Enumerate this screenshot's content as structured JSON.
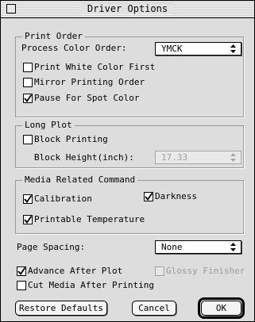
{
  "window": {
    "title": "Driver Options"
  },
  "print_order": {
    "group_title": "Print Order",
    "process_color_label": "Process Color Order:",
    "process_color_value": "YMCK",
    "print_white_first": {
      "label": "Print White Color First",
      "checked": false
    },
    "mirror_printing_order": {
      "label": "Mirror Printing Order",
      "checked": false
    },
    "pause_for_spot_color": {
      "label": "Pause For Spot Color",
      "checked": true
    }
  },
  "long_plot": {
    "group_title": "Long Plot",
    "block_printing": {
      "label": "Block Printing",
      "checked": false
    },
    "block_height_label": "Block Height(inch):",
    "block_height_value": "17.33"
  },
  "media_related": {
    "group_title": "Media Related Command",
    "calibration": {
      "label": "Calibration",
      "checked": true
    },
    "darkness": {
      "label": "Darkness",
      "checked": true
    },
    "printable_temperature": {
      "label": "Printable Temperature",
      "checked": true
    }
  },
  "page_spacing": {
    "label": "Page Spacing:",
    "value": "None"
  },
  "advance_after_plot": {
    "label": "Advance After Plot",
    "checked": true
  },
  "glossy_finisher": {
    "label": "Glossy Finisher",
    "checked": false,
    "enabled": false
  },
  "cut_media_after_printing": {
    "label": "Cut Media After Printing",
    "checked": false
  },
  "buttons": {
    "restore_defaults": "Restore Defaults",
    "cancel": "Cancel",
    "ok": "OK"
  }
}
